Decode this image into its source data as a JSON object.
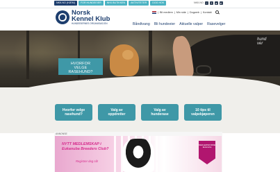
{
  "top_tabs": [
    "NKK.NO (HJEM)",
    "FOR HUNDEEIER",
    "NKK BUTIKKEN",
    "AKTIVITETER",
    "DOG HOK"
  ],
  "social": {
    "label": "NKK.NO",
    "icons": [
      "instagram-icon",
      "facebook-icon",
      "twitter-icon",
      "youtube-icon"
    ]
  },
  "logo": {
    "title_line1": "Norsk",
    "title_line2": "Kennel Klub",
    "subtitle": "HUNDEEIERNES ORGANISASJON"
  },
  "util_links": [
    "Bli medlem",
    "Min side",
    "Dogweb",
    "Kontakt"
  ],
  "nav": [
    "Båndtvang",
    "Bli hundeeier",
    "Aktuelle valper",
    "Rasevelger"
  ],
  "hero": {
    "box_line1": "HVORFOR",
    "box_line2": "VELGE",
    "box_line3": "RASEHUND?",
    "script_line1": "hund",
    "script_line2": "ver"
  },
  "features": [
    {
      "line1": "Hvorfor velge",
      "line2": "rasehund?"
    },
    {
      "line1": "Valg av",
      "line2": "oppdretter"
    },
    {
      "line1": "Valg av",
      "line2": "hunderase"
    },
    {
      "line1": "10 tips til",
      "line2": "valpekjøperen"
    }
  ],
  "ad": {
    "label": "ANNONSE",
    "title_line1": "NYTT MEDLEMSKAP i",
    "title_line2": "Eukanuba Breeders Club?",
    "subtitle": "Registrer deg nå!",
    "badge_line1": "MEDLEMSFORDELER",
    "badge_line2": "Eukanuba"
  },
  "colors": {
    "brand_navy": "#1d3e6e",
    "accent_teal": "#3f98a7",
    "ad_pink": "#d62b8c"
  }
}
